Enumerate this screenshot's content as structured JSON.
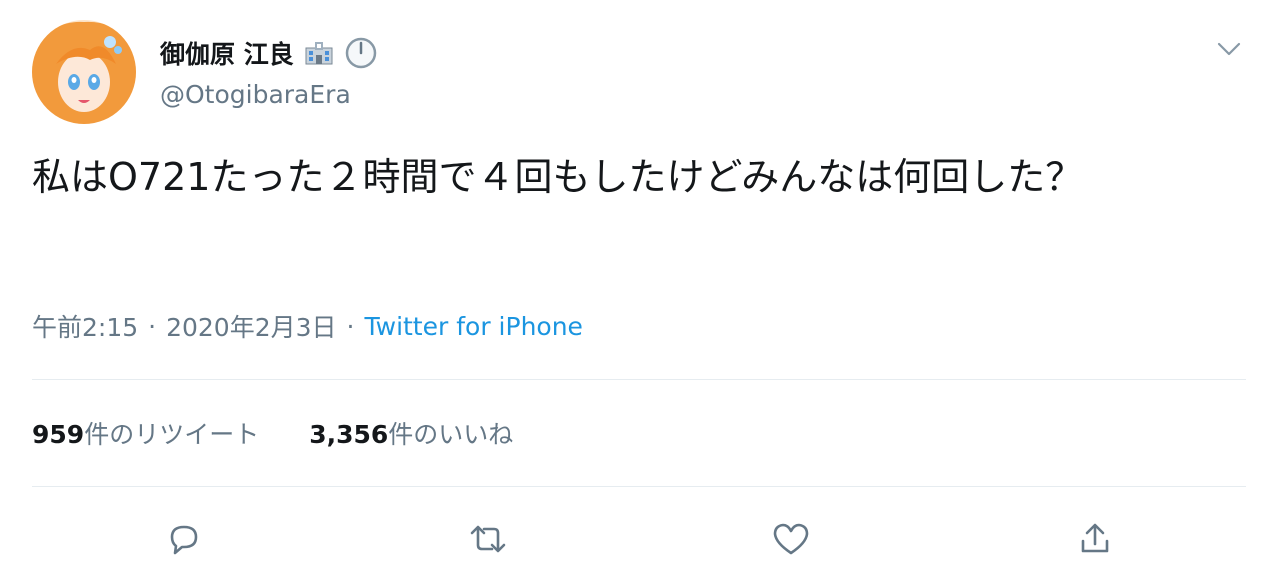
{
  "tweet": {
    "author": {
      "display_name": "御伽原 江良",
      "handle": "@OtogibaraEra"
    },
    "text": "私はO721たった２時間で４回もしたけどみんなは何回した？",
    "time": "午前2:15",
    "separator": "·",
    "date": "2020年2月3日",
    "source": "Twitter for iPhone",
    "stats": {
      "retweets_count": "959",
      "retweets_label": "件のリツイート",
      "likes_count": "3,356",
      "likes_label": "件のいいね"
    }
  },
  "colors": {
    "text_primary": "#14171a",
    "text_secondary": "#657786",
    "link": "#1b95e0",
    "divider": "#e6ecf0",
    "icon": "#657786"
  },
  "icons": {
    "name_emoji_1": "school-building-icon",
    "name_emoji_2": "clock-icon",
    "caret": "chevron-down-icon",
    "reply": "reply-icon",
    "retweet": "retweet-icon",
    "like": "heart-icon",
    "share": "share-icon"
  }
}
